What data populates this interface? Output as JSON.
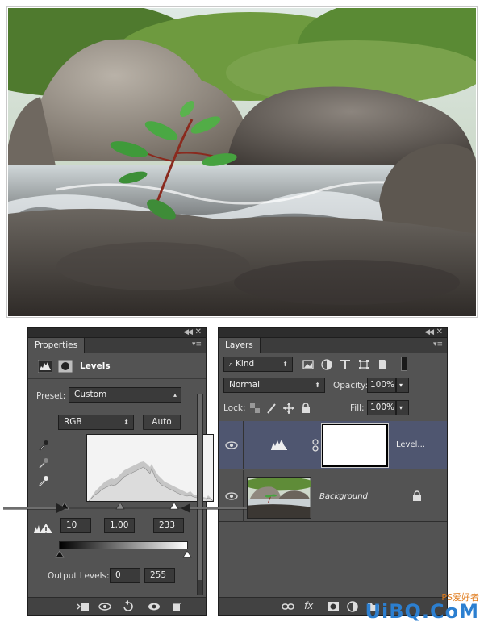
{
  "properties": {
    "tab": "Properties",
    "adjustment": "Levels",
    "preset_label": "Preset:",
    "preset_value": "Custom",
    "channel_value": "RGB",
    "auto_label": "Auto",
    "input_black": "10",
    "input_gamma": "1.00",
    "input_white": "233",
    "output_label": "Output Levels:",
    "output_black": "0",
    "output_white": "255"
  },
  "layers": {
    "tab": "Layers",
    "filter_kind": "Kind",
    "blend_mode": "Normal",
    "opacity_label": "Opacity:",
    "opacity_value": "100%",
    "lock_label": "Lock:",
    "fill_label": "Fill:",
    "fill_value": "100%",
    "items": [
      {
        "name": "Level...",
        "type": "adjustment"
      },
      {
        "name": "Background",
        "type": "image"
      }
    ]
  },
  "watermark": {
    "text": "UiBQ.CoM",
    "cn": "PS爱好者"
  },
  "icons": {
    "panel_collapse": "double-chevron-icon",
    "panel_close": "close-icon",
    "panel_menu": "panel-menu-icon",
    "visibility": "eye-icon",
    "lock": "lock-icon"
  }
}
